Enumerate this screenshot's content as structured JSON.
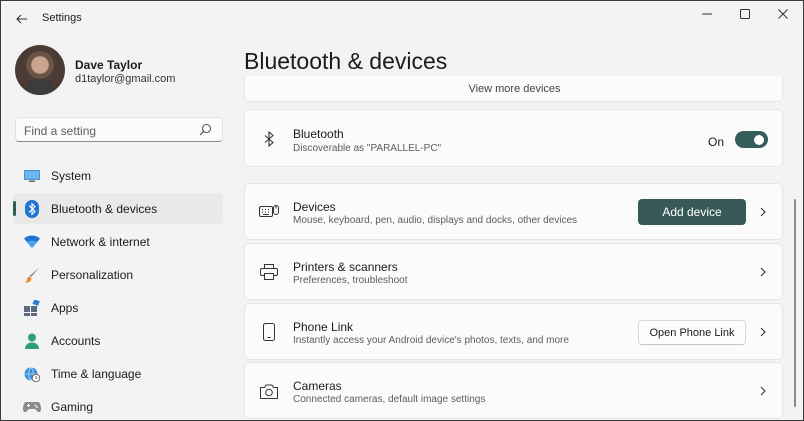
{
  "window": {
    "app_title": "Settings"
  },
  "user": {
    "name": "Dave Taylor",
    "email": "d1taylor@gmail.com"
  },
  "search": {
    "placeholder": "Find a setting"
  },
  "nav": [
    {
      "label": "System",
      "icon": "monitor-icon"
    },
    {
      "label": "Bluetooth & devices",
      "icon": "bluetooth-icon",
      "active": true
    },
    {
      "label": "Network & internet",
      "icon": "wifi-icon"
    },
    {
      "label": "Personalization",
      "icon": "paintbrush-icon"
    },
    {
      "label": "Apps",
      "icon": "apps-icon"
    },
    {
      "label": "Accounts",
      "icon": "person-icon"
    },
    {
      "label": "Time & language",
      "icon": "globe-clock-icon"
    },
    {
      "label": "Gaming",
      "icon": "gamepad-icon"
    }
  ],
  "main": {
    "title": "Bluetooth & devices",
    "view_more": "View more devices",
    "bluetooth": {
      "title": "Bluetooth",
      "subtitle": "Discoverable as \"PARALLEL-PC\"",
      "state_label": "On",
      "enabled": true
    },
    "devices": {
      "title": "Devices",
      "subtitle": "Mouse, keyboard, pen, audio, displays and docks, other devices",
      "button": "Add device"
    },
    "printers": {
      "title": "Printers & scanners",
      "subtitle": "Preferences, troubleshoot"
    },
    "phone_link": {
      "title": "Phone Link",
      "subtitle": "Instantly access your Android device's photos, texts, and more",
      "button": "Open Phone Link"
    },
    "cameras": {
      "title": "Cameras",
      "subtitle": "Connected cameras, default image settings"
    }
  },
  "colors": {
    "accent": "#375a58",
    "window_bg": "#f3f3f3",
    "card_bg": "#fbfbfb"
  }
}
